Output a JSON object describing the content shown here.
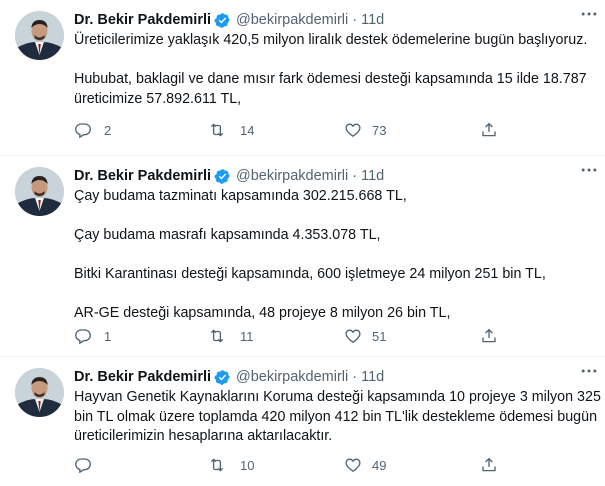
{
  "author": {
    "name": "Dr. Bekir Pakdemirli",
    "handle": "@bekirpakdemirli",
    "separator": "·",
    "time": "11d"
  },
  "colors": {
    "verified": "#1d9bf0",
    "text": "#0f1419",
    "muted": "#536471"
  },
  "icons": {
    "reply": "comment-icon",
    "retweet": "retweet-icon",
    "like": "heart-icon",
    "share": "share-icon",
    "more": "more-dots-icon",
    "verified": "verified-badge-icon"
  },
  "tweets": [
    {
      "lines": [
        "Üreticilerimize yaklaşık 420,5 milyon liralık destek ödemelerine bugün başlıyoruz.",
        "Hububat, baklagil ve dane mısır fark ödemesi desteği kapsamında 15 ilde 18.787",
        "üreticimize 57.892.611 TL,"
      ],
      "replies": "2",
      "retweets": "14",
      "likes": "73"
    },
    {
      "lines": [
        "Çay budama tazminatı kapsamında 302.215.668 TL,",
        "Çay budama masrafı kapsamında 4.353.078 TL,",
        "Bitki Karantinası desteği kapsamında, 600 işletmeye 24 milyon 251 bin TL,",
        "AR-GE desteği kapsamında, 48 projeye 8 milyon 26 bin TL,"
      ],
      "replies": "1",
      "retweets": "11",
      "likes": "51"
    },
    {
      "lines": [
        "Hayvan Genetik Kaynaklarını Koruma desteği kapsamında 10 projeye 3 milyon 325",
        "bin TL olmak üzere toplamda 420 milyon 412 bin TL'lik destekleme ödemesi bugün",
        "üreticilerimizin hesaplarına aktarılacaktır."
      ],
      "replies": "",
      "retweets": "10",
      "likes": "49"
    }
  ]
}
